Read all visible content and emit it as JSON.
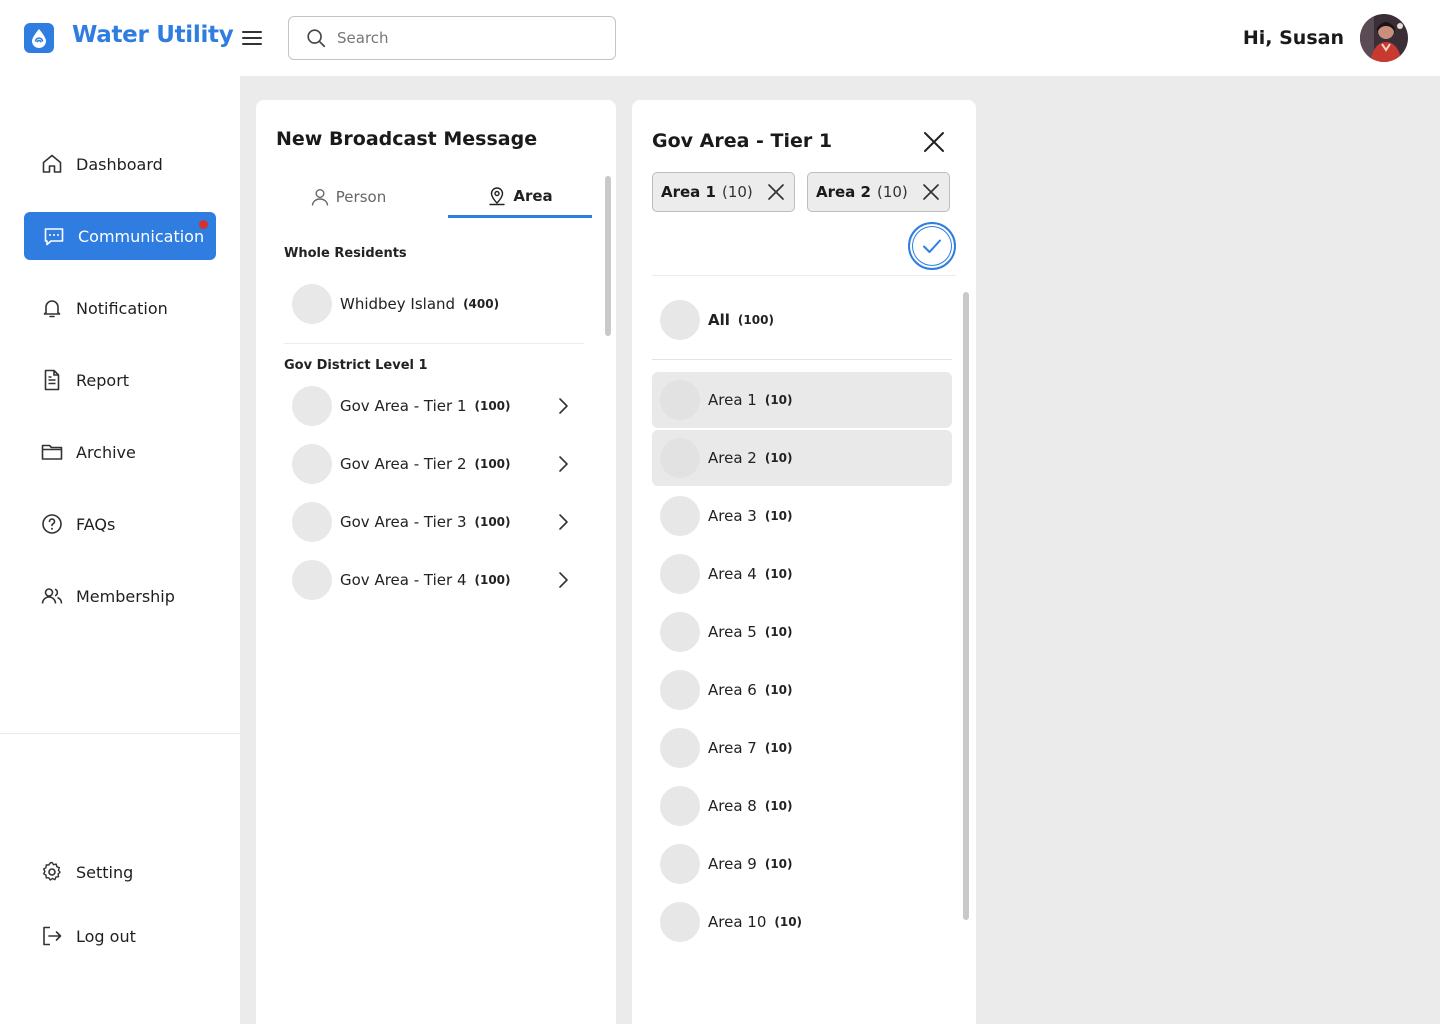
{
  "brand": {
    "app_name": "Water Utility",
    "accent": "#2f7de1"
  },
  "header": {
    "search_placeholder": "Search",
    "greeting": "Hi, Susan"
  },
  "sidebar": {
    "items": [
      {
        "label": "Dashboard",
        "icon": "home-icon"
      },
      {
        "label": "Communication",
        "icon": "message-icon",
        "active": true,
        "has_notification_dot": true
      },
      {
        "label": "Notification",
        "icon": "bell-icon"
      },
      {
        "label": "Report",
        "icon": "document-icon"
      },
      {
        "label": "Archive",
        "icon": "folder-icon"
      },
      {
        "label": "FAQs",
        "icon": "help-circle-icon"
      },
      {
        "label": "Membership",
        "icon": "users-icon"
      }
    ],
    "bottom_items": [
      {
        "label": "Setting",
        "icon": "gear-icon"
      },
      {
        "label": "Log out",
        "icon": "logout-icon"
      }
    ]
  },
  "broadcast": {
    "title": "New Broadcast Message",
    "tabs": [
      {
        "label": "Person",
        "icon": "person-icon"
      },
      {
        "label": "Area",
        "icon": "map-pin-icon",
        "active": true
      }
    ],
    "whole_residents": {
      "label": "Whole Residents",
      "items": [
        {
          "label": "Whidbey Island",
          "count": "(400)"
        }
      ]
    },
    "district": {
      "label": "Gov District Level 1",
      "items": [
        {
          "label": "Gov Area - Tier 1",
          "count": "(100)"
        },
        {
          "label": "Gov Area - Tier 2",
          "count": "(100)"
        },
        {
          "label": "Gov Area - Tier 3",
          "count": "(100)"
        },
        {
          "label": "Gov Area - Tier 4",
          "count": "(100)"
        }
      ]
    }
  },
  "tier_panel": {
    "title": "Gov Area - Tier 1",
    "chips": [
      {
        "name": "Area 1",
        "count": "(10)"
      },
      {
        "name": "Area 2",
        "count": "(10)"
      }
    ],
    "all": {
      "label": "All",
      "count": "(100)"
    },
    "areas": [
      {
        "label": "Area 1",
        "count": "(10)",
        "selected": true
      },
      {
        "label": "Area 2",
        "count": "(10)",
        "selected": true
      },
      {
        "label": "Area 3",
        "count": "(10)",
        "selected": false
      },
      {
        "label": "Area 4",
        "count": "(10)",
        "selected": false
      },
      {
        "label": "Area 5",
        "count": "(10)",
        "selected": false
      },
      {
        "label": "Area 6",
        "count": "(10)",
        "selected": false
      },
      {
        "label": "Area 7",
        "count": "(10)",
        "selected": false
      },
      {
        "label": "Area 8",
        "count": "(10)",
        "selected": false
      },
      {
        "label": "Area 9",
        "count": "(10)",
        "selected": false
      },
      {
        "label": "Area 10",
        "count": "(10)",
        "selected": false
      }
    ]
  }
}
